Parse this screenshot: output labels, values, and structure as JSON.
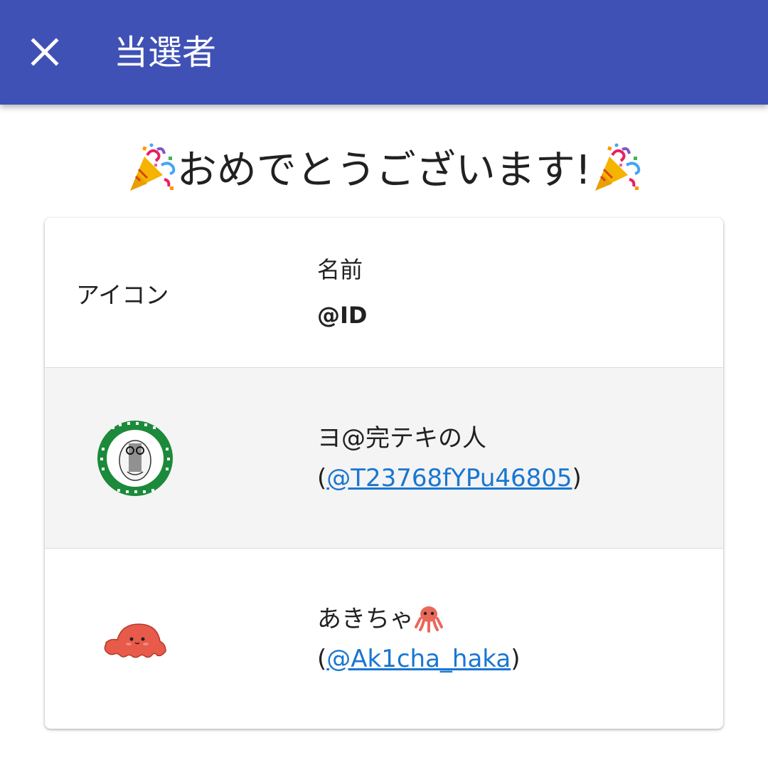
{
  "appbar": {
    "title": "当選者",
    "close_icon": "close-icon",
    "background": "#3f51b5"
  },
  "congrats": {
    "text": "おめでとうございます!",
    "emoji_icon": "party-popper-icon"
  },
  "table": {
    "header": {
      "icon_label": "アイコン",
      "name_label": "名前",
      "id_label": "@ID"
    },
    "rows": [
      {
        "avatar": "green-circular-badge-avatar",
        "name": "ヨ@完テキの人",
        "id_open": "(",
        "id": "@T23768fYPu46805",
        "id_close": ")"
      },
      {
        "avatar": "red-octopus-avatar",
        "name": "あきちゃ",
        "name_emoji": "octopus-icon",
        "id_open": "(",
        "id": "@Ak1cha_haka",
        "id_close": ")"
      }
    ]
  },
  "colors": {
    "link": "#1976d2",
    "row_alt": "#f4f4f4"
  }
}
